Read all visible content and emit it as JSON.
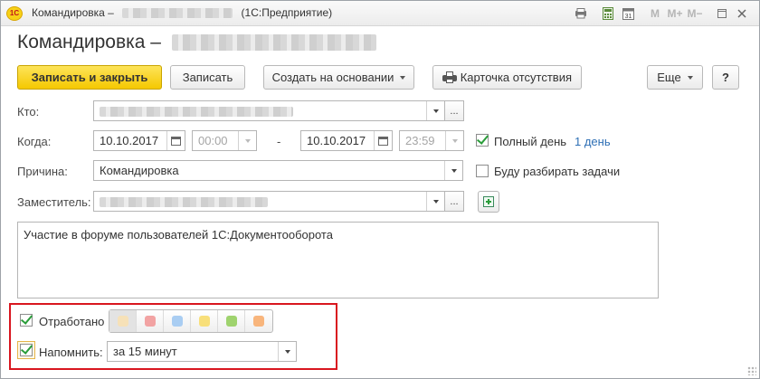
{
  "window": {
    "title_prefix": "Командировка –",
    "title_suffix": "(1С:Предприятие)",
    "app_logo": "1С",
    "icons": [
      "print-doc-icon",
      "calculator-icon",
      "calendar-icon",
      "m-icon",
      "m-plus-icon",
      "m-minus-icon",
      "restore-window-icon",
      "close-window-icon"
    ],
    "m_labels": [
      "M",
      "M+",
      "M−"
    ]
  },
  "header": {
    "title_prefix": "Командировка –"
  },
  "toolbar": {
    "save_close": "Записать и закрыть",
    "save": "Записать",
    "create_based": "Создать на основании",
    "absence_card": "Карточка отсутствия",
    "more": "Еще",
    "help": "?"
  },
  "form": {
    "who_label": "Кто:",
    "when_label": "Когда:",
    "date_from": "10.10.2017",
    "time_from": "00:00",
    "dash": "-",
    "date_to": "10.10.2017",
    "time_to": "23:59",
    "full_day_label": "Полный день",
    "full_day_checked": true,
    "days_link": "1 день",
    "reason_label": "Причина:",
    "reason_value": "Командировка",
    "handle_tasks_label": "Буду разбирать задачи",
    "handle_tasks_checked": false,
    "deputy_label": "Заместитель:",
    "select_button": "...",
    "comment": "Участие в форуме пользователей 1С:Документооборота"
  },
  "bottom": {
    "worked_label": "Отработано",
    "worked_checked": true,
    "colors": [
      "#f6e1b8",
      "#f2a3a3",
      "#a9cdf2",
      "#f8df7a",
      "#9fd36e",
      "#f8b57c"
    ],
    "remind_label": "Напомнить:",
    "remind_checked": true,
    "remind_value": "за 15 минут",
    "highlight_color": "#d9161f"
  }
}
